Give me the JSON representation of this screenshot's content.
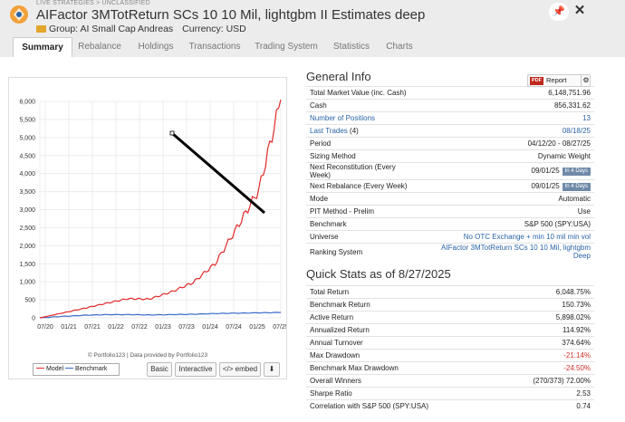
{
  "header": {
    "breadcrumb": "LIVE STRATEGIES > UNCLASSIFIED",
    "title": "AIFactor 3MTotReturn SCs 10 10 Mil, lightgbm II Estimates deep",
    "group": "Group: AI Small Cap Andreas",
    "currency": "Currency: USD"
  },
  "tabs": [
    "Summary",
    "Rebalance",
    "Holdings",
    "Transactions",
    "Trading System",
    "Statistics",
    "Charts"
  ],
  "chart_data": {
    "type": "line",
    "x": [
      "07/20",
      "01/21",
      "07/21",
      "01/22",
      "07/22",
      "01/23",
      "07/23",
      "01/24",
      "07/24",
      "01/25",
      "07/25"
    ],
    "y_ticks": [
      0,
      500,
      "1,000",
      "1,500",
      "2,000",
      "2,500",
      "3,000",
      "3,500",
      "4,000",
      "4,500",
      "5,000",
      "5,500",
      "6,000"
    ],
    "ylim": [
      0,
      6000
    ],
    "series": [
      {
        "name": "Model",
        "color": "#e02a2a",
        "values": [
          0,
          130,
          260,
          400,
          530,
          520,
          720,
          980,
          1500,
          2500,
          3550,
          6050
        ]
      },
      {
        "name": "Benchmark",
        "color": "#3a6bc8",
        "values": [
          0,
          40,
          70,
          90,
          90,
          80,
          90,
          100,
          120,
          130,
          140,
          150
        ]
      }
    ]
  },
  "chart_footer": {
    "credit": "© Portfolio123 | Data provided by Portfolio123",
    "legend_model": "Model",
    "legend_benchmark": "Benchmark",
    "btn_basic": "Basic",
    "btn_interactive": "Interactive",
    "btn_embed": "</> embed",
    "btn_download": "⬇"
  },
  "general": {
    "title": "General Info",
    "report": "Report",
    "pdf": "PDF",
    "rows": [
      {
        "label": "Total Market Value (inc. Cash)",
        "value": "6,148,751.96"
      },
      {
        "label": "Cash",
        "value": "856,331.62"
      },
      {
        "label": "Number of Positions",
        "value": "13",
        "link": true
      },
      {
        "label": "Last Trades",
        "extra": "(4)",
        "value": "08/18/25",
        "link": true
      },
      {
        "label": "Period",
        "value": "04/12/20 - 08/27/25"
      },
      {
        "label": "Sizing Method",
        "value": "Dynamic Weight"
      },
      {
        "label": "Next Reconstitution (Every Week)",
        "value": "09/01/25",
        "badge": "In 4 Days"
      },
      {
        "label": "Next Rebalance (Every Week)",
        "value": "09/01/25",
        "badge": "In 4 Days"
      },
      {
        "label": "Mode",
        "value": "Automatic"
      },
      {
        "label": "PIT Method - Prelim",
        "value": "Use"
      },
      {
        "label": "Benchmark",
        "value": "S&P 500 (SPY:USA)"
      },
      {
        "label": "Universe",
        "value": "No OTC Exchange + min 10 mil min vol",
        "valueblue": true
      },
      {
        "label": "Ranking System",
        "value": "AIFactor 3MTotReturn SCs 10 10 Mil, lightgbm Deep",
        "valueblue": true
      }
    ]
  },
  "quick": {
    "title": "Quick Stats as of 8/27/2025",
    "rows": [
      {
        "label": "Total Return",
        "value": "6,048.75%"
      },
      {
        "label": "Benchmark Return",
        "value": "150.73%"
      },
      {
        "label": "Active Return",
        "value": "5,898.02%"
      },
      {
        "label": "Annualized Return",
        "value": "114.92%"
      },
      {
        "label": "Annual Turnover",
        "value": "374.64%"
      },
      {
        "label": "Max Drawdown",
        "value": "-21.14%",
        "red": true
      },
      {
        "label": "Benchmark Max Drawdown",
        "value": "-24.50%",
        "red": true
      },
      {
        "label": "Overall Winners",
        "value": "(270/373) 72.00%"
      },
      {
        "label": "Sharpe Ratio",
        "value": "2.53"
      },
      {
        "label": "Correlation with S&P 500 (SPY:USA)",
        "value": "0.74"
      }
    ]
  }
}
